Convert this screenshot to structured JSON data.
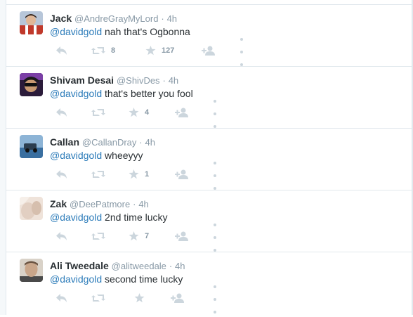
{
  "tweets": [
    {
      "name": "Jack",
      "handle": "@AndreGrayMyLord",
      "time": "4h",
      "mention": "@davidgold",
      "text": " nah that's Ogbonna",
      "retweets": "8",
      "favorites": "127",
      "avatar_color": "#c0392b"
    },
    {
      "name": "Shivam Desai",
      "handle": "@ShivDes",
      "time": "4h",
      "mention": "@davidgold",
      "text": " that's better you fool",
      "retweets": "",
      "favorites": "4",
      "avatar_color": "#5b2a86"
    },
    {
      "name": "Callan",
      "handle": "@CallanDray",
      "time": "4h",
      "mention": "@davidgold",
      "text": " wheeyyy",
      "retweets": "",
      "favorites": "1",
      "avatar_color": "#3a6fa0"
    },
    {
      "name": "Zak",
      "handle": "@DeePatmore",
      "time": "4h",
      "mention": "@davidgold",
      "text": " 2nd time lucky",
      "retweets": "",
      "favorites": "7",
      "avatar_color": "#e2cfc2"
    },
    {
      "name": "Ali Tweedale",
      "handle": "@alitweedale",
      "time": "4h",
      "mention": "@davidgold",
      "text": " second time lucky",
      "retweets": "",
      "favorites": "",
      "avatar_color": "#c9a68a"
    }
  ],
  "icons": {
    "reply": "reply-icon",
    "retweet": "retweet-icon",
    "favorite": "star-icon",
    "follow": "follow-icon",
    "more": "more-icon"
  },
  "colors": {
    "link": "#2b7bb9",
    "icon": "#ccd6dd",
    "meta": "#8899a6",
    "border": "#e1e8ed"
  }
}
